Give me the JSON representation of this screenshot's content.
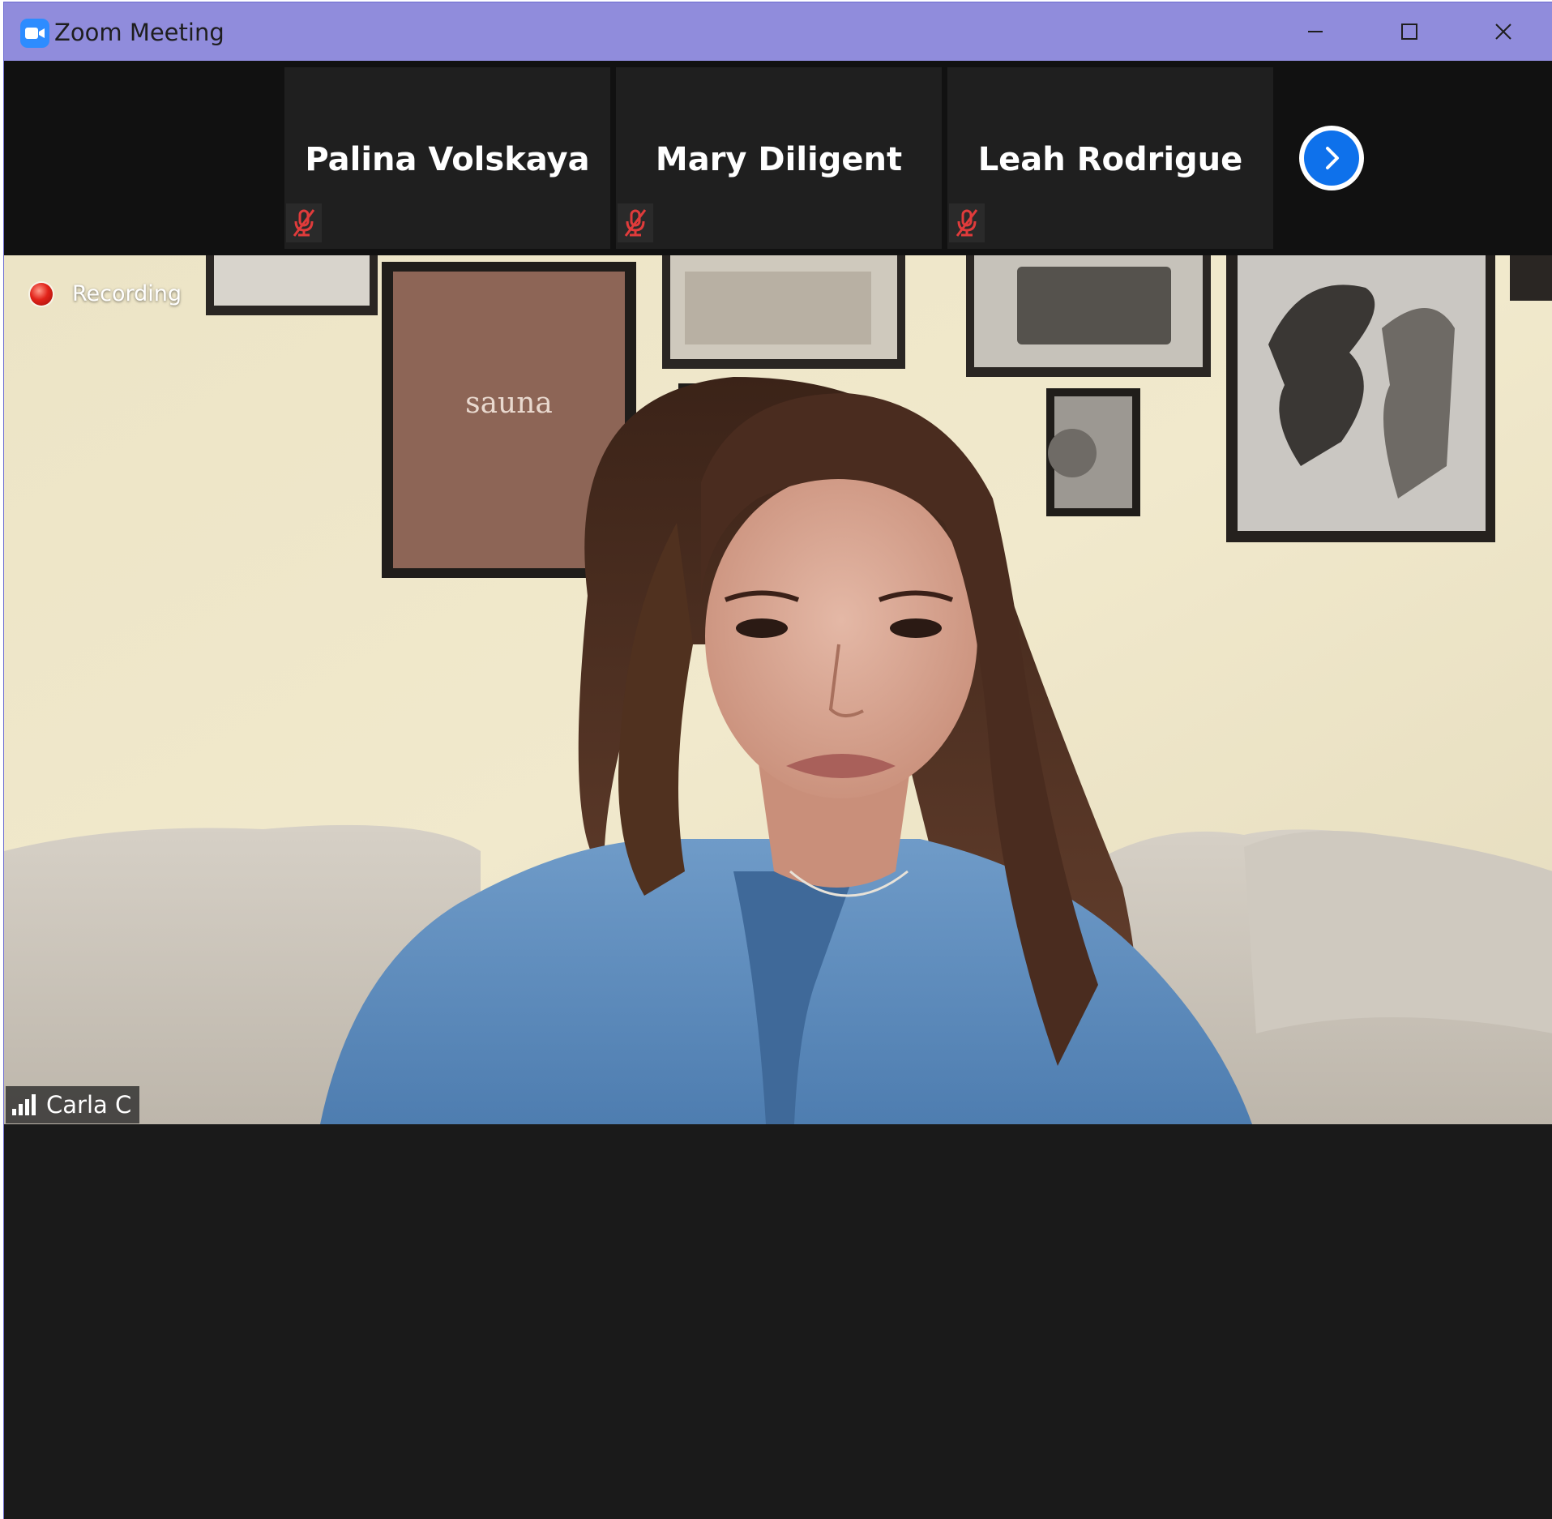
{
  "window": {
    "title": "Zoom Meeting",
    "icons": {
      "app": "zoom-camera-icon",
      "minimize": "minimize-icon",
      "maximize": "maximize-icon",
      "close": "close-icon"
    }
  },
  "participants_strip": {
    "tiles": [
      {
        "name": "Palina Volskaya",
        "muted": true,
        "icon": "mic-muted-icon"
      },
      {
        "name": "Mary Diligent",
        "muted": true,
        "icon": "mic-muted-icon"
      },
      {
        "name": "Leah Rodrigue",
        "muted": true,
        "icon": "mic-muted-icon"
      }
    ],
    "next_icon": "chevron-right-icon"
  },
  "active_speaker": {
    "recording_label": "Recording",
    "name": "Carla C",
    "signal_icon": "signal-bars-icon",
    "poster_text": "sauna"
  },
  "colors": {
    "titlebar": "#908cdc",
    "zoom_blue": "#2d8cff",
    "next_button": "#0e71eb",
    "muted_red": "#e03b3b",
    "recording_red": "#e2231a",
    "background": "#1a1a1a"
  }
}
